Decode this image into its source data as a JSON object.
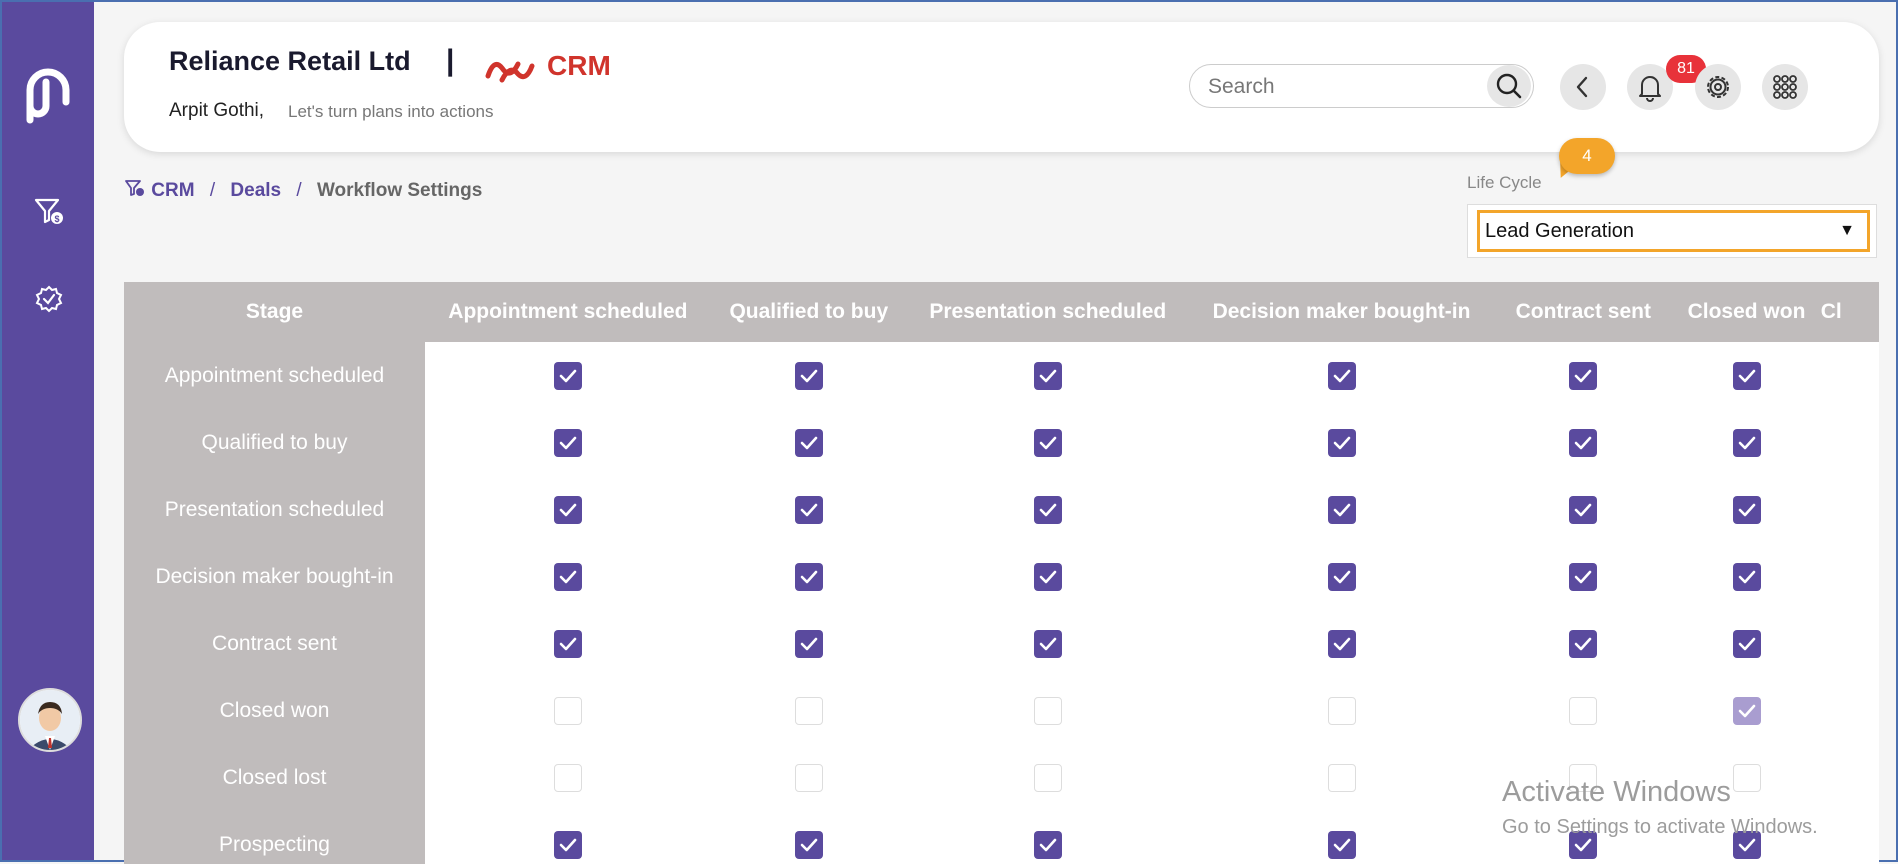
{
  "header": {
    "company": "Reliance Retail Ltd",
    "separator": "|",
    "app_name": "CRM",
    "user_name": "Arpit Gothi,",
    "tagline": "Let's turn plans into actions",
    "search_placeholder": "Search",
    "notification_count": "81"
  },
  "breadcrumb": {
    "items": [
      "CRM",
      "Deals",
      "Workflow Settings"
    ],
    "separator": "/"
  },
  "life_cycle": {
    "label": "Life Cycle",
    "selected": "Lead Generation",
    "callout_step": "4"
  },
  "table": {
    "corner_header": "Stage",
    "columns": [
      "Appointment scheduled",
      "Qualified to buy",
      "Presentation scheduled",
      "Decision maker bought-in",
      "Contract sent",
      "Closed won",
      "Cl"
    ],
    "rows": [
      {
        "stage": "Appointment scheduled",
        "cells": [
          "checked",
          "checked",
          "checked",
          "checked",
          "checked",
          "checked"
        ]
      },
      {
        "stage": "Qualified to buy",
        "cells": [
          "checked",
          "checked",
          "checked",
          "checked",
          "checked",
          "checked"
        ]
      },
      {
        "stage": "Presentation scheduled",
        "cells": [
          "checked",
          "checked",
          "checked",
          "checked",
          "checked",
          "checked"
        ]
      },
      {
        "stage": "Decision maker bought-in",
        "cells": [
          "checked",
          "checked",
          "checked",
          "checked",
          "checked",
          "checked"
        ]
      },
      {
        "stage": "Contract sent",
        "cells": [
          "checked",
          "checked",
          "checked",
          "checked",
          "checked",
          "checked"
        ]
      },
      {
        "stage": "Closed won",
        "cells": [
          "unchecked",
          "unchecked",
          "unchecked",
          "unchecked",
          "unchecked",
          "disabled"
        ]
      },
      {
        "stage": "Closed lost",
        "cells": [
          "unchecked",
          "unchecked",
          "unchecked",
          "unchecked",
          "unchecked",
          "unchecked"
        ]
      },
      {
        "stage": "Prospecting",
        "cells": [
          "checked",
          "checked",
          "checked",
          "checked",
          "checked",
          "checked"
        ]
      }
    ]
  },
  "watermark": {
    "title": "Activate Windows",
    "subtitle": "Go to Settings to activate Windows."
  },
  "colors": {
    "brand": "#5a4a9e",
    "crm_red": "#d0342c",
    "callout": "#f3a52a",
    "table_header": "#c0bcbc",
    "badge": "#e8323a"
  }
}
